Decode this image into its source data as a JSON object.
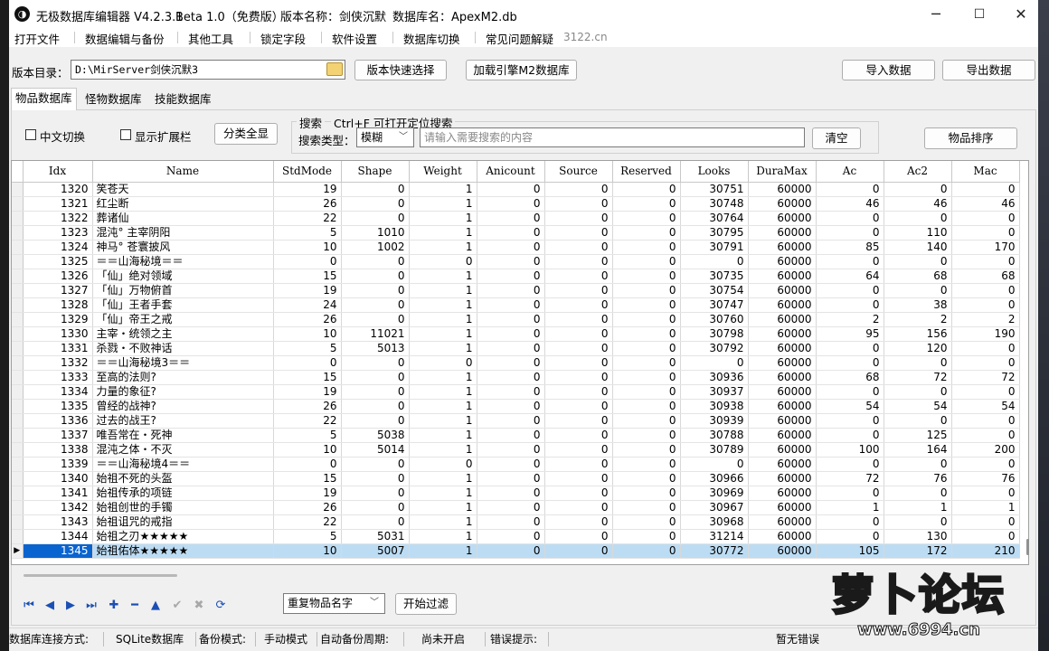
{
  "window": {
    "app_title": "无极数据库编辑器 V4.2.3.1",
    "edition": "Beta 1.0（免费版）",
    "version_name": "版本名称：剑侠沉默",
    "database_name": "数据库名：ApexM2.db",
    "minimize": "─",
    "maximize": "☐",
    "close": "✕"
  },
  "menu": {
    "items": [
      "打开文件",
      "数据编辑与备份",
      "其他工具",
      "锁定字段",
      "软件设置",
      "数据库切换",
      "常见问题解疑"
    ],
    "url": "3122.cn"
  },
  "toolbar": {
    "dir_label": "版本目录：",
    "dir_value": "D:\\MirServer剑侠沉默3",
    "quick_select": "版本快速选择",
    "load_engine": "加载引擎M2数据库",
    "import": "导入数据",
    "export": "导出数据"
  },
  "tabs": [
    "物品数据库",
    "怪物数据库",
    "技能数据库"
  ],
  "filters": {
    "chinese_toggle": "中文切换",
    "show_ext": "显示扩展栏",
    "show_all": "分类全显",
    "search_title": "搜索",
    "search_hint": "Ctrl+F 可打开定位搜索",
    "search_type_label": "搜索类型：",
    "search_type_value": "模糊",
    "search_placeholder": "请输入需要搜索的内容",
    "clear": "清空",
    "sort": "物品排序"
  },
  "grid": {
    "columns": [
      "Idx",
      "Name",
      "StdMode",
      "Shape",
      "Weight",
      "Anicount",
      "Source",
      "Reserved",
      "Looks",
      "DuraMax",
      "Ac",
      "Ac2",
      "Mac"
    ],
    "rows": [
      [
        "1320",
        "笑苍天",
        "19",
        "0",
        "1",
        "0",
        "0",
        "0",
        "30751",
        "60000",
        "0",
        "0",
        "0"
      ],
      [
        "1321",
        "红尘断",
        "26",
        "0",
        "1",
        "0",
        "0",
        "0",
        "30748",
        "60000",
        "46",
        "46",
        "46"
      ],
      [
        "1322",
        "葬诸仙",
        "22",
        "0",
        "1",
        "0",
        "0",
        "0",
        "30764",
        "60000",
        "0",
        "0",
        "0"
      ],
      [
        "1323",
        "混沌° 主宰阴阳",
        "5",
        "1010",
        "1",
        "0",
        "0",
        "0",
        "30795",
        "60000",
        "0",
        "110",
        "0"
      ],
      [
        "1324",
        "神马° 苍寰披风",
        "10",
        "1002",
        "1",
        "0",
        "0",
        "0",
        "30791",
        "60000",
        "85",
        "140",
        "170"
      ],
      [
        "1325",
        "＝＝山海秘境＝＝",
        "0",
        "0",
        "0",
        "0",
        "0",
        "0",
        "0",
        "60000",
        "0",
        "0",
        "0"
      ],
      [
        "1326",
        "「仙」绝对领域",
        "15",
        "0",
        "1",
        "0",
        "0",
        "0",
        "30735",
        "60000",
        "64",
        "68",
        "68"
      ],
      [
        "1327",
        "「仙」万物俯首",
        "19",
        "0",
        "1",
        "0",
        "0",
        "0",
        "30754",
        "60000",
        "0",
        "0",
        "0"
      ],
      [
        "1328",
        "「仙」王者手套",
        "24",
        "0",
        "1",
        "0",
        "0",
        "0",
        "30747",
        "60000",
        "0",
        "38",
        "0"
      ],
      [
        "1329",
        "「仙」帝王之戒",
        "26",
        "0",
        "1",
        "0",
        "0",
        "0",
        "30760",
        "60000",
        "2",
        "2",
        "2"
      ],
      [
        "1330",
        "主宰・统领之主",
        "10",
        "11021",
        "1",
        "0",
        "0",
        "0",
        "30798",
        "60000",
        "95",
        "156",
        "190"
      ],
      [
        "1331",
        "杀戮・不败神话",
        "5",
        "5013",
        "1",
        "0",
        "0",
        "0",
        "30792",
        "60000",
        "0",
        "120",
        "0"
      ],
      [
        "1332",
        "＝＝山海秘境3＝＝",
        "0",
        "0",
        "0",
        "0",
        "0",
        "0",
        "0",
        "60000",
        "0",
        "0",
        "0"
      ],
      [
        "1333",
        "至高的法则?",
        "15",
        "0",
        "1",
        "0",
        "0",
        "0",
        "30936",
        "60000",
        "68",
        "72",
        "72"
      ],
      [
        "1334",
        "力量的象征?",
        "19",
        "0",
        "1",
        "0",
        "0",
        "0",
        "30937",
        "60000",
        "0",
        "0",
        "0"
      ],
      [
        "1335",
        "曾经的战神?",
        "26",
        "0",
        "1",
        "0",
        "0",
        "0",
        "30938",
        "60000",
        "54",
        "54",
        "54"
      ],
      [
        "1336",
        "过去的战王?",
        "22",
        "0",
        "1",
        "0",
        "0",
        "0",
        "30939",
        "60000",
        "0",
        "0",
        "0"
      ],
      [
        "1337",
        "唯吾常在・死神",
        "5",
        "5038",
        "1",
        "0",
        "0",
        "0",
        "30788",
        "60000",
        "0",
        "125",
        "0"
      ],
      [
        "1338",
        "混沌之体・不灭",
        "10",
        "5014",
        "1",
        "0",
        "0",
        "0",
        "30789",
        "60000",
        "100",
        "164",
        "200"
      ],
      [
        "1339",
        "＝＝山海秘境4＝＝",
        "0",
        "0",
        "0",
        "0",
        "0",
        "0",
        "0",
        "60000",
        "0",
        "0",
        "0"
      ],
      [
        "1340",
        "始祖不死的头盔",
        "15",
        "0",
        "1",
        "0",
        "0",
        "0",
        "30966",
        "60000",
        "72",
        "76",
        "76"
      ],
      [
        "1341",
        "始祖传承的项链",
        "19",
        "0",
        "1",
        "0",
        "0",
        "0",
        "30969",
        "60000",
        "0",
        "0",
        "0"
      ],
      [
        "1342",
        "始祖创世的手镯",
        "26",
        "0",
        "1",
        "0",
        "0",
        "0",
        "30967",
        "60000",
        "1",
        "1",
        "1"
      ],
      [
        "1343",
        "始祖诅咒的戒指",
        "22",
        "0",
        "1",
        "0",
        "0",
        "0",
        "30968",
        "60000",
        "0",
        "0",
        "0"
      ],
      [
        "1344",
        "始祖之刃★★★★★",
        "5",
        "5031",
        "1",
        "0",
        "0",
        "0",
        "31214",
        "60000",
        "0",
        "130",
        "0"
      ],
      [
        "1345",
        "始祖佑体★★★★★",
        "10",
        "5007",
        "1",
        "0",
        "0",
        "0",
        "30772",
        "60000",
        "105",
        "172",
        "210"
      ]
    ],
    "selected_index": 25,
    "row_indicator": "▶"
  },
  "navigator": {
    "buttons": [
      {
        "name": "first-record-icon",
        "glyph": "⏮"
      },
      {
        "name": "prior-record-icon",
        "glyph": "◀"
      },
      {
        "name": "next-record-icon",
        "glyph": "▶"
      },
      {
        "name": "last-record-icon",
        "glyph": "⏭"
      },
      {
        "name": "insert-record-icon",
        "glyph": "✚"
      },
      {
        "name": "delete-record-icon",
        "glyph": "━"
      },
      {
        "name": "edit-record-icon",
        "glyph": "▲"
      },
      {
        "name": "post-record-icon",
        "glyph": "✔"
      },
      {
        "name": "cancel-record-icon",
        "glyph": "✖"
      },
      {
        "name": "refresh-record-icon",
        "glyph": "⟳"
      }
    ],
    "duplicate_filter_value": "重复物品名字",
    "start_filter": "开始过滤"
  },
  "status": {
    "conn_label": "数据库连接方式:",
    "conn_value": "SQLite数据库",
    "backup_label": "备份模式:",
    "backup_value": "手动模式",
    "auto_label": "自动备份周期:",
    "auto_value": "尚未开启",
    "error_label": "错误提示:",
    "error_value": "暂无错误"
  },
  "watermark": {
    "text": "萝卜论坛",
    "url": "www.6994.cn"
  },
  "colors": {
    "selection": "#bcdcf4",
    "selected_idx": "#0a64d0",
    "nav_blue": "#1b4fb3"
  }
}
